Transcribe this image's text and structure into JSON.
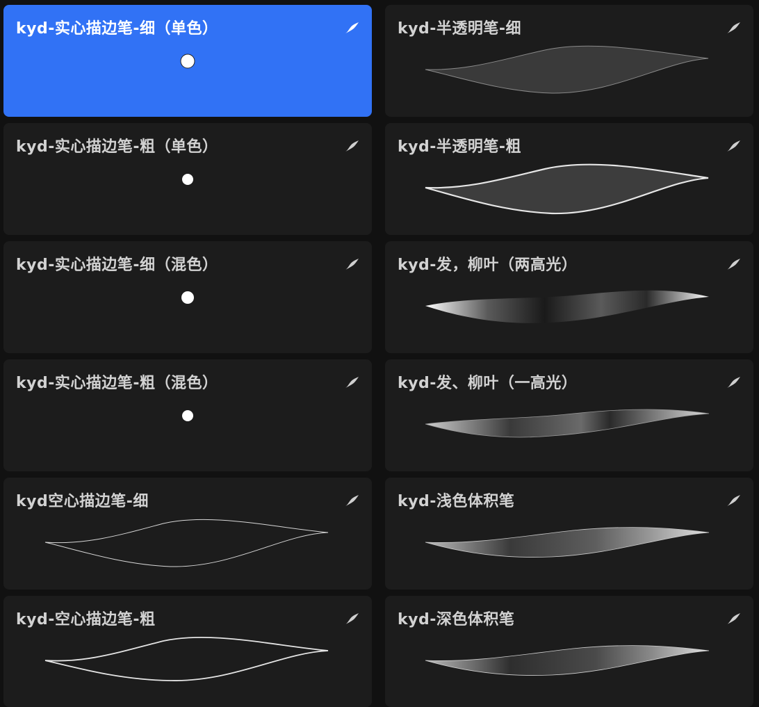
{
  "brushes": [
    {
      "name": "kyd-实心描边笔-细（单色）",
      "selected": true,
      "preview": "dot",
      "icon": "brush-stroke-icon"
    },
    {
      "name": "kyd-半透明笔-细",
      "selected": false,
      "preview": "translucent-thin",
      "icon": "brush-stroke-icon"
    },
    {
      "name": "kyd-实心描边笔-粗（单色）",
      "selected": false,
      "preview": "dot",
      "icon": "brush-stroke-icon"
    },
    {
      "name": "kyd-半透明笔-粗",
      "selected": false,
      "preview": "translucent-thick",
      "icon": "brush-stroke-icon"
    },
    {
      "name": "kyd-实心描边笔-细（混色）",
      "selected": false,
      "preview": "dot",
      "icon": "brush-stroke-icon"
    },
    {
      "name": "kyd-发，柳叶（两高光）",
      "selected": false,
      "preview": "leaf-two",
      "icon": "brush-stroke-icon"
    },
    {
      "name": "kyd-实心描边笔-粗（混色）",
      "selected": false,
      "preview": "dot",
      "icon": "brush-stroke-icon"
    },
    {
      "name": "kyd-发、柳叶（一高光）",
      "selected": false,
      "preview": "leaf-one",
      "icon": "brush-stroke-icon"
    },
    {
      "name": "kyd空心描边笔-细",
      "selected": false,
      "preview": "outline-thin",
      "icon": "brush-stroke-icon"
    },
    {
      "name": "kyd-浅色体积笔",
      "selected": false,
      "preview": "volume-light",
      "icon": "brush-stroke-icon"
    },
    {
      "name": "kyd-空心描边笔-粗",
      "selected": false,
      "preview": "outline-thick",
      "icon": "brush-stroke-icon"
    },
    {
      "name": "kyd-深色体积笔",
      "selected": false,
      "preview": "volume-dark",
      "icon": "brush-stroke-icon"
    }
  ],
  "colors": {
    "background": "#111111",
    "card": "#1c1c1c",
    "selected_card": "#3172f5",
    "title_text": "#d2d2d2",
    "selected_title_text": "#ffffff"
  }
}
